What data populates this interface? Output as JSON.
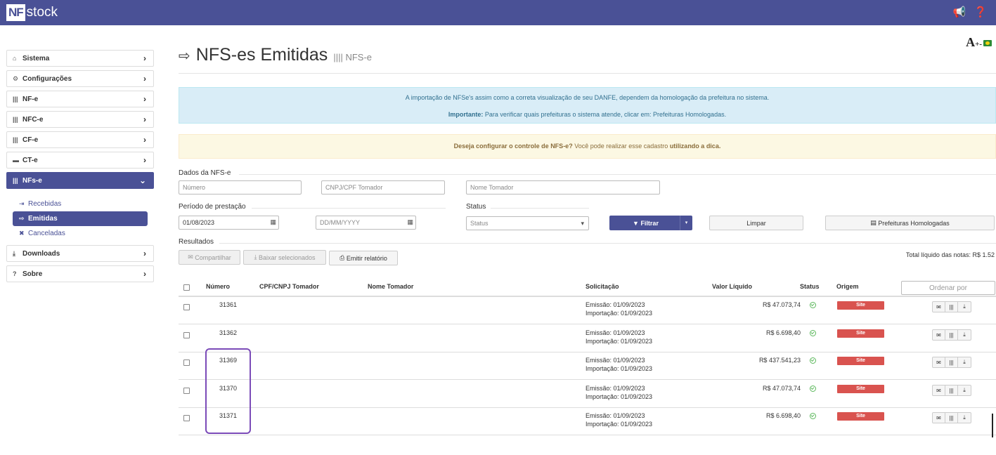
{
  "header": {
    "logo_nf": "NF",
    "logo_stock": "stock",
    "icons": [
      "megaphone-icon",
      "help-icon"
    ]
  },
  "font_controls": {
    "big": "A",
    "plus_minus": "+-"
  },
  "sidebar": {
    "items": [
      {
        "label": "Sistema",
        "icon": "home-icon",
        "glyph": "⌂"
      },
      {
        "label": "Configurações",
        "icon": "gear-icon",
        "glyph": "⚙"
      },
      {
        "label": "NF-e",
        "icon": "barcode-icon",
        "glyph": "|||"
      },
      {
        "label": "NFC-e",
        "icon": "barcode-icon",
        "glyph": "|||"
      },
      {
        "label": "CF-e",
        "icon": "barcode-icon",
        "glyph": "|||"
      },
      {
        "label": "CT-e",
        "icon": "truck-icon",
        "glyph": "▬"
      },
      {
        "label": "NFs-e",
        "icon": "barcode-icon",
        "glyph": "|||"
      }
    ],
    "sub_items": [
      {
        "label": "Recebidas",
        "glyph": "⇥"
      },
      {
        "label": "Emitidas",
        "glyph": "⇨"
      },
      {
        "label": "Canceladas",
        "glyph": "✖"
      }
    ],
    "bottom_items": [
      {
        "label": "Downloads",
        "glyph": "⤓"
      },
      {
        "label": "Sobre",
        "glyph": "?"
      }
    ]
  },
  "page": {
    "title": "NFS-es Emitidas",
    "subtitle": "NFS-e"
  },
  "alerts": {
    "info_line1": "A importação de NFSe's assim como a correta visualização de seu DANFE, dependem da homologação da prefeitura no sistema.",
    "info_line2_bold": "Importante:",
    "info_line2": "Para verificar quais prefeituras o sistema atende, clicar em: Prefeituras Homologadas.",
    "warn_bold": "Deseja configurar o controle de NFS-e?",
    "warn_text": "Você pode realizar esse cadastro",
    "warn_link": "utilizando a dica."
  },
  "form": {
    "section_dados": "Dados da NFS-e",
    "numero_placeholder": "Número",
    "cnpj_placeholder": "CNPJ/CPF Tomador",
    "nome_placeholder": "Nome Tomador",
    "section_periodo": "Período de prestação",
    "date_from": "01/08/2023",
    "date_to_placeholder": "DD/MM/YYYY",
    "section_status": "Status",
    "status_placeholder": "Status",
    "filtrar": "Filtrar",
    "limpar": "Limpar",
    "prefeituras": "Prefeituras Homologadas"
  },
  "results": {
    "section": "Resultados",
    "compartilhar": "Compartilhar",
    "baixar": "Baixar selecionados",
    "emitir": "Emitir relatório",
    "total": "Total líquido das notas: R$ 1.52"
  },
  "table": {
    "headers": {
      "numero": "Número",
      "cnpj": "CPF/CNPJ Tomador",
      "nome": "Nome Tomador",
      "solicitacao": "Solicitação",
      "valor": "Valor Líquido",
      "status": "Status",
      "origem": "Origem",
      "ordenar": "Ordenar por"
    },
    "rows": [
      {
        "numero": "31361",
        "emissao": "Emissão: 01/09/2023",
        "importacao": "Importação: 01/09/2023",
        "valor": "R$ 47.073,74",
        "origem": "Site"
      },
      {
        "numero": "31362",
        "emissao": "Emissão: 01/09/2023",
        "importacao": "Importação: 01/09/2023",
        "valor": "R$ 6.698,40",
        "origem": "Site"
      },
      {
        "numero": "31369",
        "emissao": "Emissão: 01/09/2023",
        "importacao": "Importação: 01/09/2023",
        "valor": "R$ 437.541,23",
        "origem": "Site"
      },
      {
        "numero": "31370",
        "emissao": "Emissão: 01/09/2023",
        "importacao": "Importação: 01/09/2023",
        "valor": "R$ 47.073,74",
        "origem": "Site"
      },
      {
        "numero": "31371",
        "emissao": "Emissão: 01/09/2023",
        "importacao": "Importação: 01/09/2023",
        "valor": "R$ 6.698,40",
        "origem": "Site"
      }
    ]
  },
  "colors": {
    "brand": "#4a5196",
    "origin_badge": "#d9534f",
    "status_ok": "#5cb85c"
  }
}
